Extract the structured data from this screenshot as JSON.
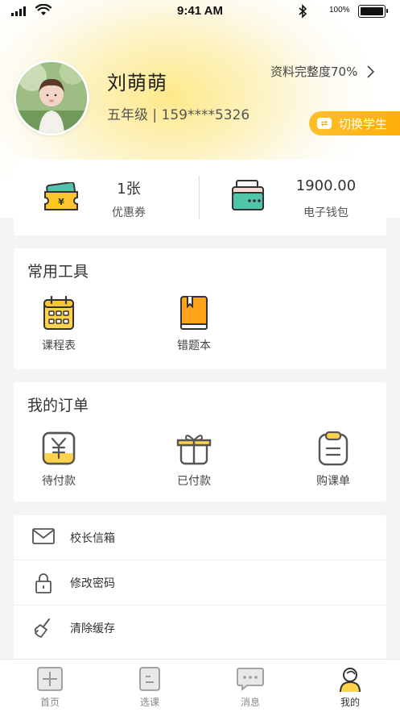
{
  "status_bar": {
    "time": "9:41 AM",
    "battery_percent": "100%"
  },
  "profile": {
    "name": "刘萌萌",
    "info": "五年级 | 159****5326",
    "completeness": "资料完整度70%",
    "switch_label": "切换学生"
  },
  "wallet": {
    "coupon_value": "1张",
    "coupon_label": "优惠券",
    "ewallet_value": "1900.00",
    "ewallet_label": "电子钱包"
  },
  "tools": {
    "title": "常用工具",
    "items": [
      {
        "label": "课程表",
        "icon": "calendar-icon"
      },
      {
        "label": "错题本",
        "icon": "notebook-icon"
      }
    ]
  },
  "orders": {
    "title": "我的订单",
    "items": [
      {
        "label": "待付款",
        "icon": "pending-payment-icon"
      },
      {
        "label": "已付款",
        "icon": "paid-gift-icon"
      },
      {
        "label": "购课单",
        "icon": "clipboard-icon"
      }
    ]
  },
  "menu": {
    "items": [
      {
        "label": "校长信箱",
        "icon": "mail-icon"
      },
      {
        "label": "修改密码",
        "icon": "lock-icon"
      },
      {
        "label": "清除缓存",
        "icon": "broom-icon"
      }
    ]
  },
  "tab_bar": {
    "items": [
      {
        "label": "首页",
        "icon": "home-plus-icon"
      },
      {
        "label": "选课",
        "icon": "course-select-icon"
      },
      {
        "label": "消息",
        "icon": "message-icon"
      },
      {
        "label": "我的",
        "icon": "profile-icon"
      }
    ],
    "active": "我的"
  },
  "colors": {
    "accent": "#ffb20f",
    "accent_light": "#fde98a",
    "background": "#f4f4f4"
  }
}
